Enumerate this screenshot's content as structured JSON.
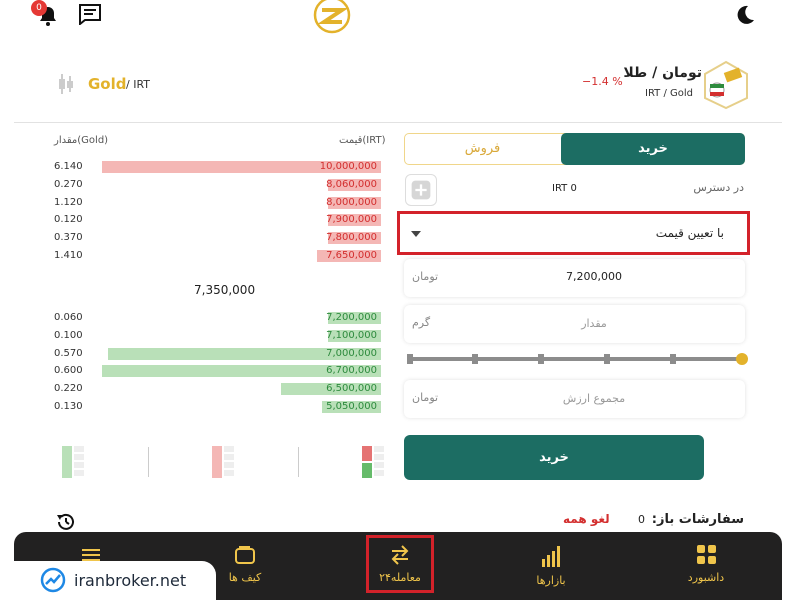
{
  "header": {
    "notification_count": "0",
    "icons": [
      "bell-icon",
      "chat-icon",
      "logo",
      "moon-icon"
    ]
  },
  "pair": {
    "title": "تومان / طلا",
    "subtitle": "IRT / Gold",
    "change": "−1.4 %",
    "asset": "Gold",
    "quote": "/ IRT"
  },
  "order_book": {
    "price_header": "قیمت(IRT)",
    "qty_header": "مقدار(Gold)",
    "asks": [
      {
        "price": "10,000,000",
        "qty": "6.140",
        "depth": 1.0
      },
      {
        "price": "8,060,000",
        "qty": "0.270",
        "depth": 0.19
      },
      {
        "price": "8,000,000",
        "qty": "1.120",
        "depth": 0.19
      },
      {
        "price": "7,900,000",
        "qty": "0.120",
        "depth": 0.19
      },
      {
        "price": "7,800,000",
        "qty": "0.370",
        "depth": 0.19
      },
      {
        "price": "7,650,000",
        "qty": "1.410",
        "depth": 0.23
      }
    ],
    "mid_price": "7,350,000",
    "bids": [
      {
        "price": "7,200,000",
        "qty": "0.060",
        "depth": 0.19
      },
      {
        "price": "7,100,000",
        "qty": "0.100",
        "depth": 0.19
      },
      {
        "price": "7,000,000",
        "qty": "0.570",
        "depth": 0.98
      },
      {
        "price": "6,700,000",
        "qty": "0.600",
        "depth": 1.0
      },
      {
        "price": "6,500,000",
        "qty": "0.220",
        "depth": 0.36
      },
      {
        "price": "5,050,000",
        "qty": "0.130",
        "depth": 0.21
      }
    ]
  },
  "form": {
    "tab_buy": "خرید",
    "tab_sell": "فروش",
    "available_label": "در دسترس",
    "available_value": "IRT 0",
    "order_type": "با تعیین قیمت",
    "price_value": "7,200,000",
    "price_unit": "تومان",
    "amount_placeholder": "مقدار",
    "amount_unit": "گرم",
    "total_placeholder": "مجموع ارزش",
    "total_unit": "تومان",
    "slider_percent": 100,
    "submit": "خرید"
  },
  "open_orders": {
    "title": "سفارشات باز:",
    "count": "0",
    "cancel_all": "لغو همه"
  },
  "nav": {
    "dashboard": "داشبورد",
    "markets": "بازارها",
    "trade": "معامله۲۴",
    "wallet": "کیف ها"
  },
  "watermark": "iranbroker.net",
  "colors": {
    "accent_green": "#1c6d63",
    "gold": "#e3b22b",
    "ask_bar": "#f4b7b5",
    "bid_bar": "#b9e0b8",
    "ask_text": "#d32f2f",
    "bid_text": "#2e8b3e",
    "nav_bg": "#222121",
    "highlight": "#d3222a"
  }
}
